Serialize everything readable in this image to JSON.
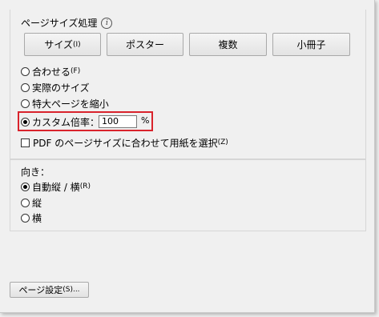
{
  "page_size_handling": {
    "title": "ページサイズ処理",
    "info_icon": "info-icon",
    "buttons": [
      {
        "label": "サイズ",
        "hotkey": "(I)"
      },
      {
        "label": "ポスター"
      },
      {
        "label": "複数"
      },
      {
        "label": "小冊子"
      }
    ],
    "options": [
      {
        "label": "合わせる",
        "hotkey": "(F)",
        "checked": false
      },
      {
        "label": "実際のサイズ",
        "checked": false
      },
      {
        "label": "特大ページを縮小",
        "checked": false
      },
      {
        "label": "カスタム倍率：",
        "checked": true
      }
    ],
    "custom_scale": {
      "value": "100",
      "unit": "%"
    },
    "choose_paper_by_pdf_size": {
      "label": "PDF のページサイズに合わせて用紙を選択",
      "hotkey": "(Z)",
      "checked": false
    }
  },
  "orientation": {
    "title": "向き：",
    "options": [
      {
        "label": "自動縦 / 横",
        "hotkey": "(R)",
        "checked": true
      },
      {
        "label": "縦",
        "checked": false
      },
      {
        "label": "横",
        "checked": false
      }
    ]
  },
  "page_setup": {
    "label": "ページ設定",
    "hotkey": "(S)..."
  },
  "colors": {
    "highlight_border": "#d9232c"
  }
}
